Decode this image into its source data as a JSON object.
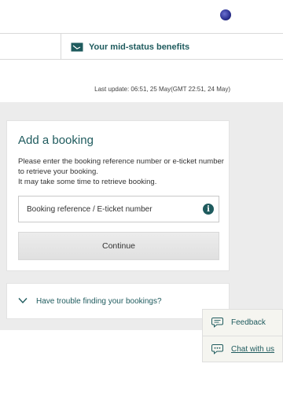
{
  "header": {
    "logo_icon": "airline-logo-icon"
  },
  "benefits": {
    "label": "Your mid-status benefits",
    "icon": "ticket-icon"
  },
  "last_update": "Last update: 06:51, 25 May(GMT 22:51, 24 May)",
  "booking_card": {
    "title": "Add a booking",
    "description_line1": "Please enter the booking reference number or e-ticket number to retrieve your booking.",
    "description_line2": "It may take some time to retrieve booking.",
    "input_placeholder": "Booking reference / E-ticket number",
    "info_icon_glyph": "i",
    "continue_label": "Continue"
  },
  "trouble": {
    "label": "Have trouble finding your bookings?",
    "icon": "chevron-down-icon"
  },
  "float_panel": {
    "feedback_label": "Feedback",
    "chat_label": "Chat with us"
  },
  "colors": {
    "accent": "#1f5b5e",
    "gray_background": "#ececec"
  }
}
